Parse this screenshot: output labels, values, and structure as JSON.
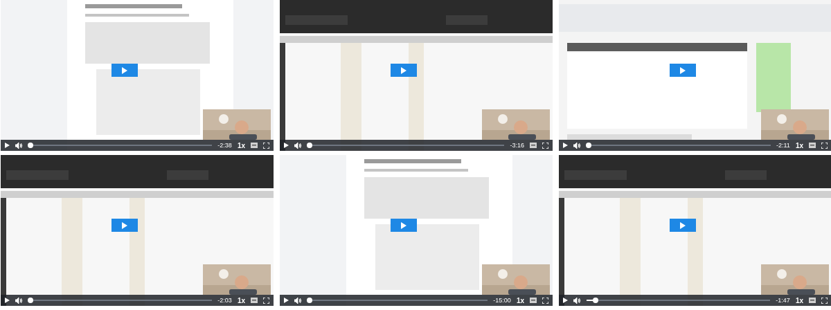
{
  "videos": [
    {
      "kind": "picture",
      "level": 0.01,
      "time": "-2:38",
      "speed": "1x"
    },
    {
      "kind": "picture",
      "level": 0.01,
      "time": "-3:16"
    },
    {
      "kind": "picture",
      "level": 0.01,
      "time": "-2:11",
      "speed": "1x"
    },
    {
      "kind": "picture",
      "level": 0.01,
      "time": "-2:03",
      "speed": "1x"
    },
    {
      "kind": "picture",
      "level": 0.01,
      "time": "-15:00",
      "speed": "1x"
    },
    {
      "kind": "picture",
      "level": 0.05,
      "time": "-1:47",
      "speed": "1x"
    }
  ]
}
